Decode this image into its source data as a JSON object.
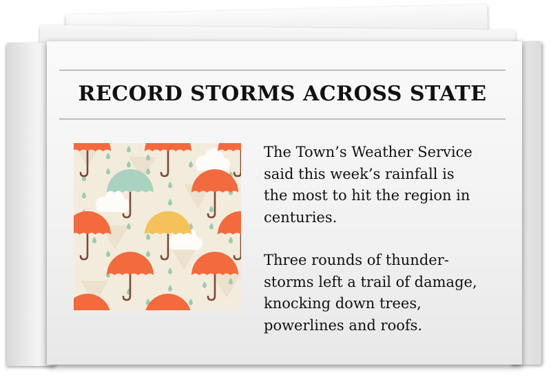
{
  "headline": "RECORD STORMS ACROSS STATE",
  "article": {
    "paragraph_1": "The Town’s Weather Service\nsaid this week’s rainfall is\nthe most to hit the region in\ncenturies.",
    "paragraph_2": "Three rounds of thunder-\nstorms left a trail of damage,\nknocking down trees,\npowerlines and roofs."
  },
  "illustration": {
    "subject": "umbrellas and raindrops pattern",
    "colors": {
      "orange": "#f26a3d",
      "teal": "#a9d3c0",
      "yellow": "#f4c15a",
      "background": "#f3ecdc",
      "drop": "#9ccab3"
    }
  }
}
